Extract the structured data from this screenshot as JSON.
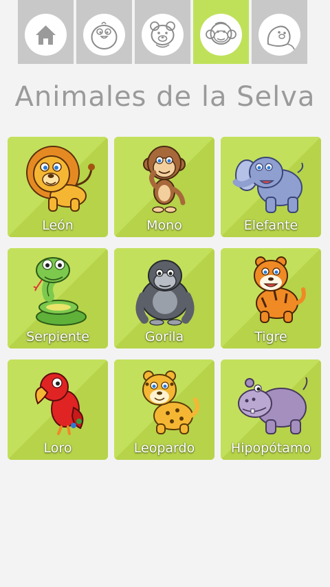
{
  "tabs": [
    {
      "icon": "home-icon",
      "active": false
    },
    {
      "icon": "bird-icon",
      "active": false
    },
    {
      "icon": "bear-icon",
      "active": false
    },
    {
      "icon": "monkey-icon",
      "active": true
    },
    {
      "icon": "seal-icon",
      "active": false
    }
  ],
  "title": "Animales de la Selva",
  "colors": {
    "accent": "#bfe15a",
    "tab_inactive": "#c8c8c8",
    "title": "#9a9a9a",
    "card": "#c3e05c"
  },
  "animals": [
    {
      "label": "León",
      "icon": "lion-icon"
    },
    {
      "label": "Mono",
      "icon": "monkey-icon"
    },
    {
      "label": "Elefante",
      "icon": "elephant-icon"
    },
    {
      "label": "Serpiente",
      "icon": "snake-icon"
    },
    {
      "label": "Gorila",
      "icon": "gorilla-icon"
    },
    {
      "label": "Tigre",
      "icon": "tiger-icon"
    },
    {
      "label": "Loro",
      "icon": "parrot-icon"
    },
    {
      "label": "Leopardo",
      "icon": "leopard-icon"
    },
    {
      "label": "Hipopótamo",
      "icon": "hippo-icon"
    }
  ]
}
